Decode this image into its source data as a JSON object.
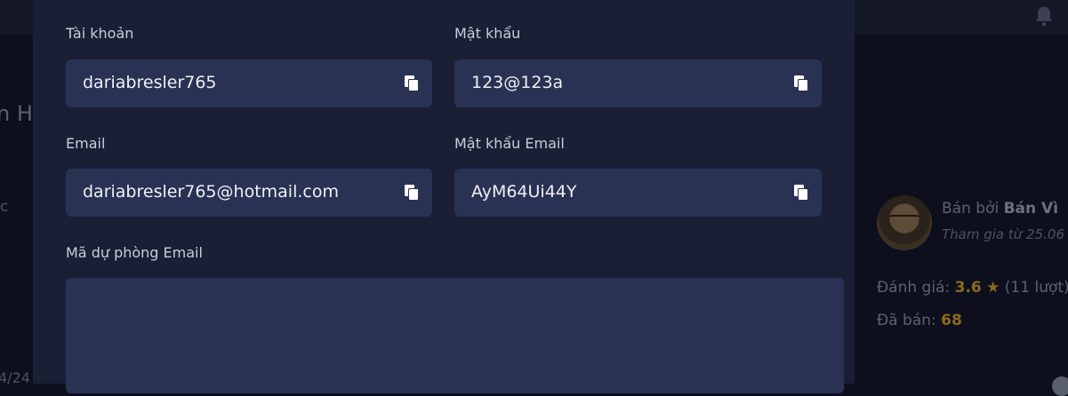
{
  "background": {
    "title_fragment": "n H",
    "fragment_c": "c",
    "date_fragment": "4/24",
    "seller": {
      "sold_by_label": "Bán bởi",
      "seller_name": "Bán Vì",
      "joined": "Tham gia từ 25.06"
    },
    "rating": {
      "label": "Đánh giá:",
      "value": "3.6",
      "count": "(11 lượt)"
    },
    "sold": {
      "label": "Đã bán:",
      "value": "68"
    },
    "icons": [
      "bell-icon",
      "star-icon",
      "copy-icon"
    ],
    "colors": {
      "modal_bg": "#1a1f36",
      "field_bg": "#2a3253",
      "accent": "#8a6a22"
    }
  },
  "account": {
    "username_label": "Tài khoản",
    "username": "dariabresler765",
    "password_label": "Mật khẩu",
    "password": "123@123a",
    "email_label": "Email",
    "email": "dariabresler765@hotmail.com",
    "email_password_label": "Mật khẩu Email",
    "email_password": "AyM64Ui44Y",
    "backup_code_label": "Mã dự phòng Email",
    "backup_code": ""
  }
}
